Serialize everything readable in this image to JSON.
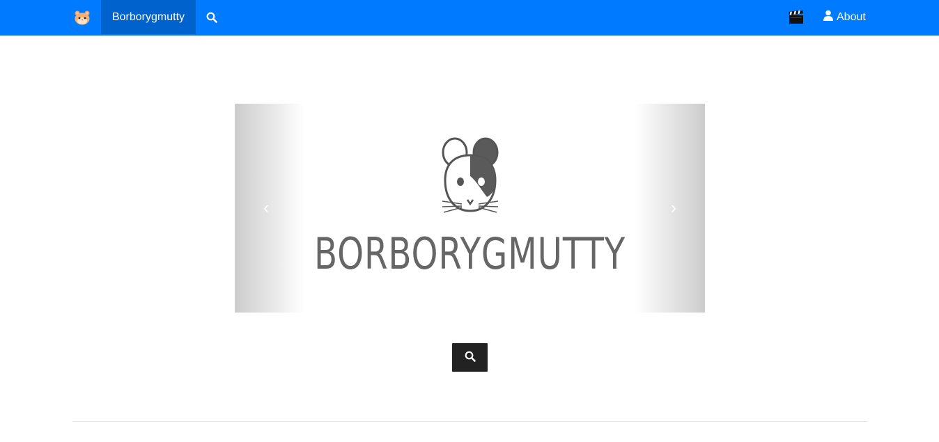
{
  "navbar": {
    "bg_color": "#007bff",
    "active_bg_color": "#0062cc",
    "logo_icon": "hamster-face-icon",
    "brand": "Borborygmutty",
    "search_icon": "search-icon",
    "movie_icon": "clapperboard-icon",
    "about": "About",
    "about_icon": "user-icon"
  },
  "carousel": {
    "slide_text": "BORBORYGMUTTY",
    "slide_icon": "hamster-logo-icon",
    "prev_glyph": "‹",
    "next_glyph": "›"
  },
  "main": {
    "search_button_icon": "search-icon",
    "search_button_color": "#222222"
  }
}
